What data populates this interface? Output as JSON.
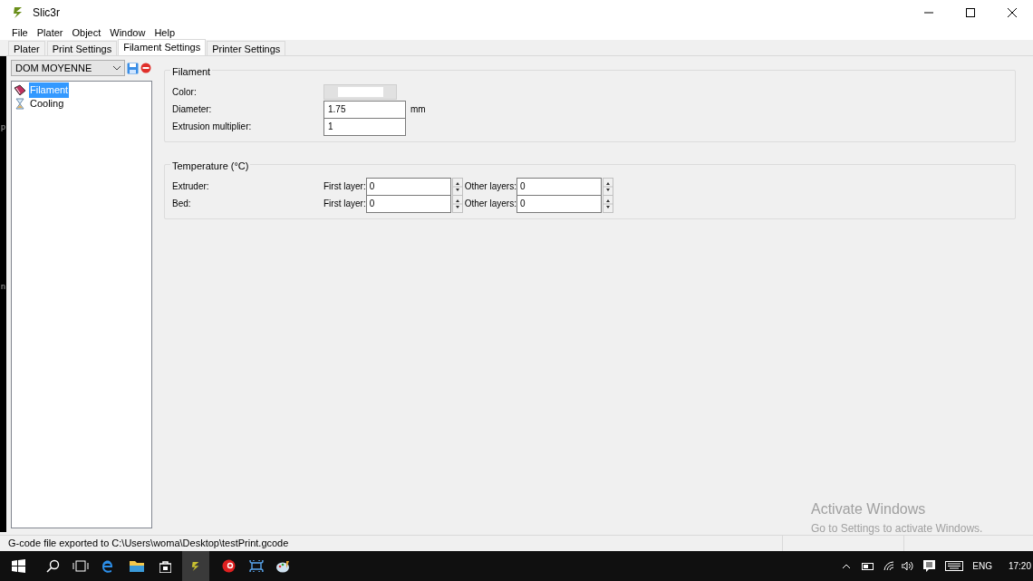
{
  "window": {
    "title": "Slic3r"
  },
  "menu": [
    "File",
    "Plater",
    "Object",
    "Window",
    "Help"
  ],
  "tabs": [
    {
      "label": "Plater",
      "selected": false
    },
    {
      "label": "Print Settings",
      "selected": false
    },
    {
      "label": "Filament Settings",
      "selected": true
    },
    {
      "label": "Printer Settings",
      "selected": false
    }
  ],
  "preset": {
    "value": "DOM MOYENNE"
  },
  "sidebar": {
    "items": [
      {
        "label": "Filament",
        "selected": true,
        "kind": "filament"
      },
      {
        "label": "Cooling",
        "selected": false,
        "kind": "cooling"
      }
    ]
  },
  "groups": [
    {
      "title": "Filament",
      "rows": [
        {
          "label": "Color:",
          "kind": "color"
        },
        {
          "label": "Diameter:",
          "kind": "text",
          "value": "1.75",
          "unit": "mm"
        },
        {
          "label": "Extrusion multiplier:",
          "kind": "text",
          "value": "1"
        }
      ]
    },
    {
      "title": "Temperature (°C)",
      "rows": [
        {
          "label": "Extruder:",
          "kind": "pair",
          "fields": [
            {
              "label": "First layer:",
              "value": "0"
            },
            {
              "label": "Other layers:",
              "value": "0"
            }
          ]
        },
        {
          "label": "Bed:",
          "kind": "pair",
          "fields": [
            {
              "label": "First layer:",
              "value": "0"
            },
            {
              "label": "Other layers:",
              "value": "0"
            }
          ]
        }
      ]
    }
  ],
  "status_bar": {
    "text": "G-code file exported to C:\\Users\\woma\\Desktop\\testPrint.gcode"
  },
  "edge_letters": [
    "p",
    "n"
  ],
  "activation_notice": {
    "title": "Activate Windows",
    "text": "Go to Settings to activate Windows."
  },
  "taskbar": {
    "language": "ENG",
    "time": "17:20"
  }
}
